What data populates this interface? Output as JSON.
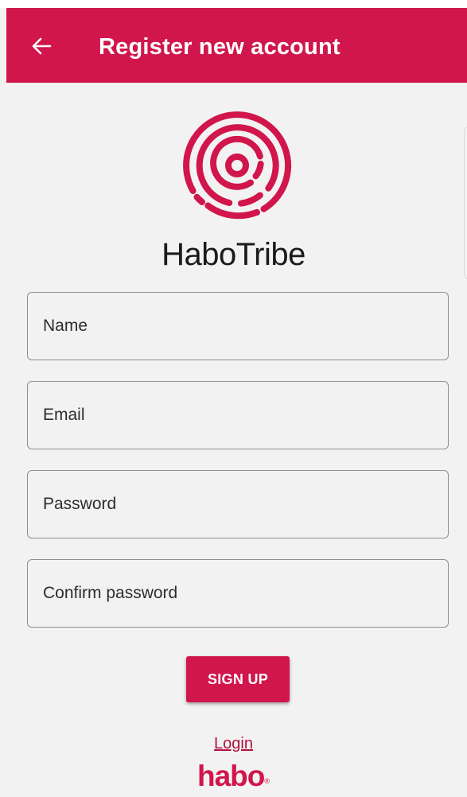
{
  "colors": {
    "brand": "#d1164c",
    "background": "#f2f2f2",
    "field_border": "#8f8f8f",
    "link": "#b0123f"
  },
  "app_bar": {
    "back_icon": "arrow-left-icon",
    "title": "Register new account"
  },
  "logo": {
    "icon": "habotribe-concentric-logo-icon",
    "brand_name": "HaboTribe"
  },
  "form": {
    "name_placeholder": "Name",
    "email_placeholder": "Email",
    "password_placeholder": "Password",
    "confirm_password_placeholder": "Confirm password",
    "signup_label": "SIGN UP"
  },
  "footer": {
    "login_link": "Login",
    "brand_logo_text": "habo",
    "brand_logo_mark": "®"
  }
}
